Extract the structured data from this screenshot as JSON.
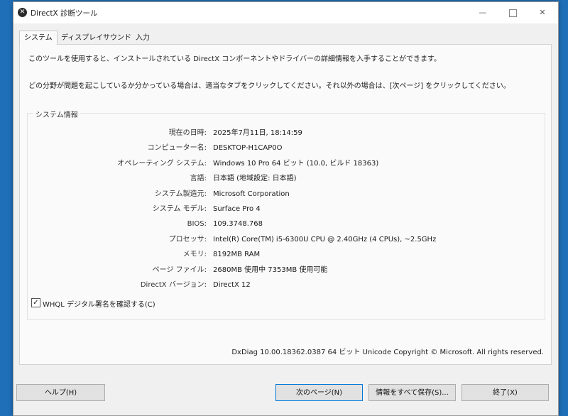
{
  "window": {
    "title": "DirectX 診断ツール",
    "icon": "directx-icon",
    "controls": {
      "minimize": "—",
      "close": "✕"
    }
  },
  "tabs": [
    {
      "label": "システム",
      "active": true
    },
    {
      "label": "ディスプレイ",
      "active": false
    },
    {
      "label": "サウンド",
      "active": false
    },
    {
      "label": "入力",
      "active": false
    }
  ],
  "intro": {
    "line1": "このツールを使用すると、インストールされている DirectX コンポーネントやドライバーの詳細情報を入手することができます。",
    "line2": "どの分野が問題を起こしているか分かっている場合は、適当なタブをクリックしてください。それ以外の場合は、[次ページ] をクリックしてください。"
  },
  "system_info": {
    "title": "システム情報",
    "rows": [
      {
        "label": "現在の日時:",
        "value": "2025年7月11日, 18:14:59"
      },
      {
        "label": "コンピューター名:",
        "value": "DESKTOP-H1CAP0O"
      },
      {
        "label": "オペレーティング システム:",
        "value": "Windows 10 Pro 64 ビット (10.0, ビルド 18363)"
      },
      {
        "label": "言語:",
        "value": "日本語 (地域設定: 日本語)"
      },
      {
        "label": "システム製造元:",
        "value": "Microsoft Corporation"
      },
      {
        "label": "システム モデル:",
        "value": "Surface Pro 4"
      },
      {
        "label": "BIOS:",
        "value": "109.3748.768"
      },
      {
        "label": "プロセッサ:",
        "value": "Intel(R) Core(TM) i5-6300U CPU @ 2.40GHz (4 CPUs), ~2.5GHz"
      },
      {
        "label": "メモリ:",
        "value": "8192MB RAM"
      },
      {
        "label": "ページ ファイル:",
        "value": "2680MB 使用中 7353MB 使用可能"
      },
      {
        "label": "DirectX バージョン:",
        "value": "DirectX 12"
      }
    ]
  },
  "whql_checkbox": {
    "label": "WHQL デジタル署名を確認する(C)",
    "checked": true,
    "mark": "✓"
  },
  "footer_info": "DxDiag 10.00.18362.0387 64 ビット Unicode  Copyright © Microsoft. All rights reserved.",
  "buttons": {
    "help": "ヘルプ(H)",
    "next": "次のページ(N)",
    "save": "情報をすべて保存(S)...",
    "exit": "終了(X)"
  },
  "colors": {
    "desktop": "#1f6fb8",
    "window_bg": "#f0f0f0",
    "default_button_border": "#0078d7"
  }
}
